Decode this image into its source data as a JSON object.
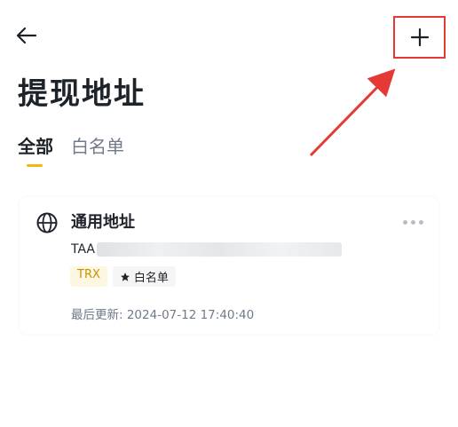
{
  "header": {
    "back_icon": "arrow-left-icon",
    "add_icon": "plus-icon",
    "annotation_color": "#e53935"
  },
  "page": {
    "title": "提现地址"
  },
  "tabs": [
    {
      "label": "全部",
      "active": true
    },
    {
      "label": "白名单",
      "active": false
    }
  ],
  "address_card": {
    "name": "通用地址",
    "address_visible_prefix": "TAA",
    "network_badge": "TRX",
    "whitelist_badge": "白名单",
    "last_updated": "最后更新: 2024-07-12 17:40:40",
    "icon": "globe-icon",
    "more_icon": "more-dots-icon"
  },
  "colors": {
    "accent": "#f0b90b",
    "text_primary": "#1e2329",
    "text_secondary": "#707a8a",
    "badge_network_bg": "#fdf6e0",
    "badge_network_fg": "#c99400"
  }
}
